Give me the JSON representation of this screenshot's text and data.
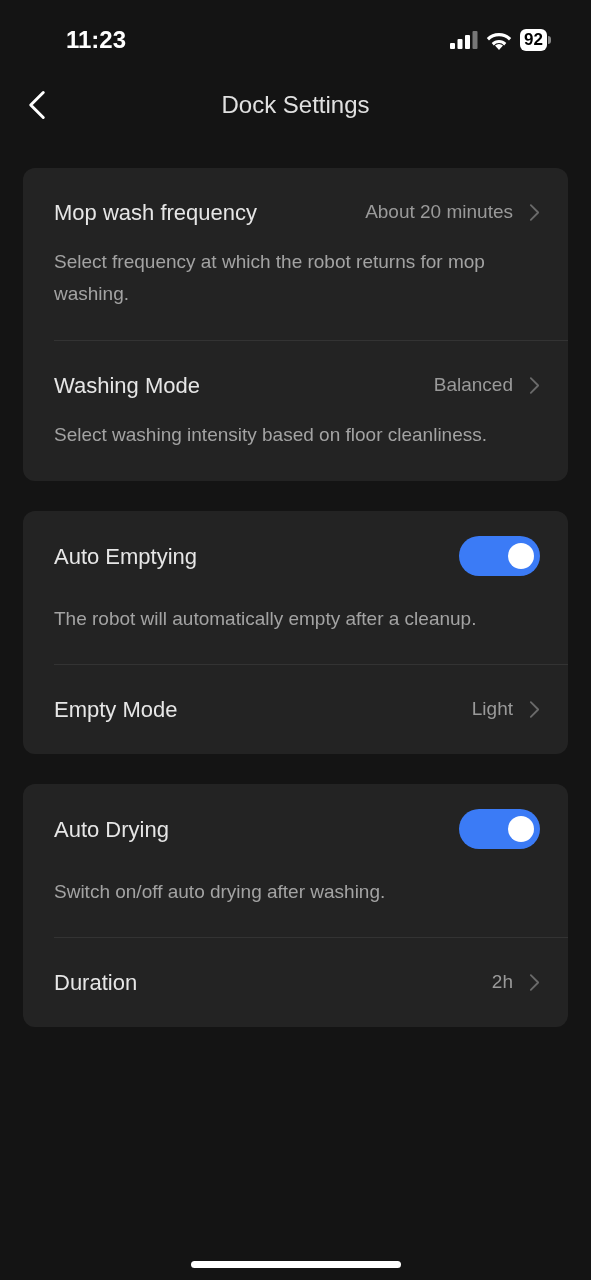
{
  "status_bar": {
    "time": "11:23",
    "battery": "92"
  },
  "header": {
    "title": "Dock Settings"
  },
  "sections": [
    {
      "rows": [
        {
          "kind": "nav",
          "title": "Mop wash frequency",
          "value": "About 20 minutes",
          "description": "Select frequency at which the robot returns for mop washing."
        },
        {
          "kind": "nav",
          "title": "Washing Mode",
          "value": "Balanced",
          "description": "Select washing intensity based on floor cleanliness."
        }
      ]
    },
    {
      "rows": [
        {
          "kind": "toggle",
          "title": "Auto Emptying",
          "on": true,
          "description": "The robot will automatically empty after a cleanup."
        },
        {
          "kind": "nav",
          "title": "Empty Mode",
          "value": "Light"
        }
      ]
    },
    {
      "rows": [
        {
          "kind": "toggle",
          "title": "Auto Drying",
          "on": true,
          "description": "Switch on/off auto drying after washing."
        },
        {
          "kind": "nav",
          "title": "Duration",
          "value": "2h"
        }
      ]
    }
  ]
}
